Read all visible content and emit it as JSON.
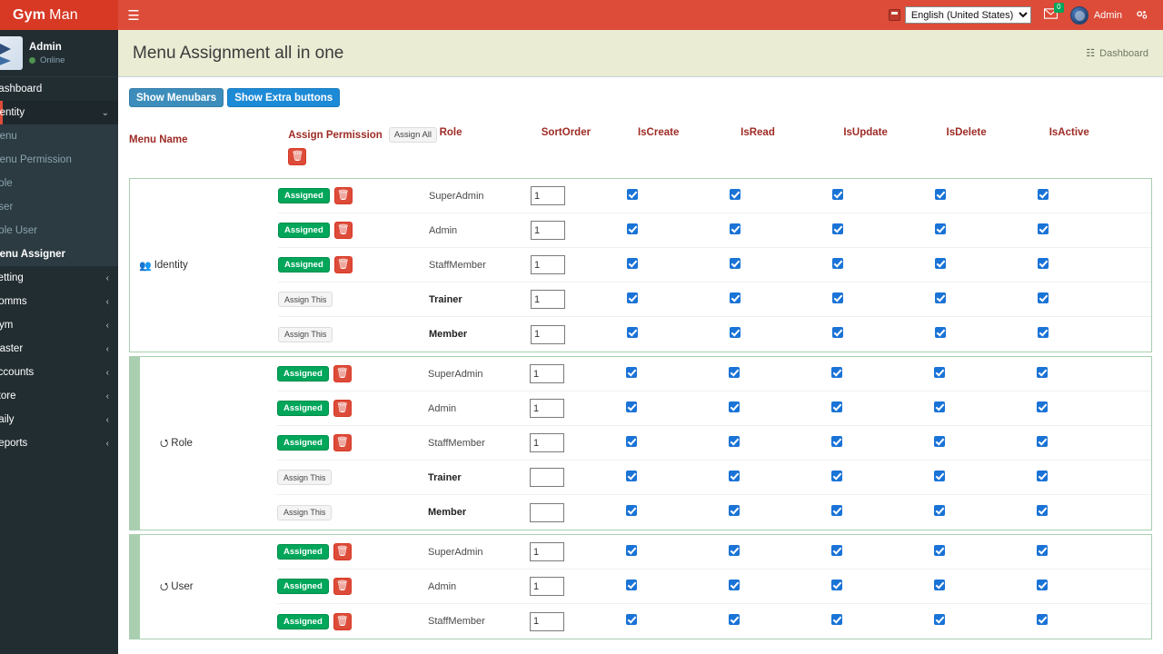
{
  "navbar": {
    "brand_bold": "Gym",
    "brand_light": "Man",
    "toggle_icon": "hamburger-icon",
    "language": {
      "flag_icon": "flag-icon",
      "selected": "English (United States)",
      "options": [
        "English (United States)"
      ]
    },
    "messages": {
      "icon": "envelope-icon",
      "badge": "0"
    },
    "user": {
      "avatar_icon": "avatar-icon",
      "name": "Admin"
    },
    "settings_icon": "gear-icon"
  },
  "sidebar": {
    "user_panel": {
      "name": "Admin",
      "status": "Online"
    },
    "items": [
      {
        "label": "Dashboard",
        "type": "top",
        "caret": ""
      },
      {
        "label": "Identity",
        "type": "active-parent",
        "caret": "⌄"
      },
      {
        "label": "Menu",
        "type": "sub",
        "caret": ""
      },
      {
        "label": "Menu Permission",
        "type": "sub",
        "caret": ""
      },
      {
        "label": "Role",
        "type": "sub",
        "caret": ""
      },
      {
        "label": "User",
        "type": "sub",
        "caret": ""
      },
      {
        "label": "Role User",
        "type": "sub",
        "caret": ""
      },
      {
        "label": "Menu Assigner",
        "type": "sub-active",
        "caret": ""
      },
      {
        "label": "Setting",
        "type": "top",
        "caret": "‹"
      },
      {
        "label": "Comms",
        "type": "top",
        "caret": "‹"
      },
      {
        "label": "Gym",
        "type": "top",
        "caret": "‹"
      },
      {
        "label": "Master",
        "type": "top",
        "caret": "‹"
      },
      {
        "label": "Accounts",
        "type": "top",
        "caret": "‹"
      },
      {
        "label": "Store",
        "type": "top",
        "caret": "‹"
      },
      {
        "label": "Daily",
        "type": "top",
        "caret": "‹"
      },
      {
        "label": "Reports",
        "type": "top",
        "caret": "‹"
      }
    ]
  },
  "page": {
    "title": "Menu Assignment all in one",
    "breadcrumb": {
      "icon": "dashboard-icon",
      "label": "Dashboard"
    }
  },
  "toolbar": {
    "show_menubars": "Show Menubars",
    "show_extra_buttons": "Show Extra buttons"
  },
  "table": {
    "headers": {
      "menu_name": "Menu Name",
      "assign_permission": "Assign Permission",
      "assign_all_button": "Assign All",
      "header_trash_icon": "trash-icon",
      "role": "Role",
      "sort_order": "SortOrder",
      "is_create": "IsCreate",
      "is_read": "IsRead",
      "is_update": "IsUpdate",
      "is_delete": "IsDelete",
      "is_active": "IsActive"
    },
    "labels": {
      "assigned": "Assigned",
      "assign_this": "Assign This",
      "row_trash_icon": "trash-icon"
    },
    "groups": [
      {
        "name": "Identity",
        "icon": "users-icon",
        "thick_border": false,
        "rows": [
          {
            "assigned": true,
            "role": "SuperAdmin",
            "bold": false,
            "sort": "1",
            "create": true,
            "read": true,
            "update": true,
            "delete": true,
            "active": true
          },
          {
            "assigned": true,
            "role": "Admin",
            "bold": false,
            "sort": "1",
            "create": true,
            "read": true,
            "update": true,
            "delete": true,
            "active": true
          },
          {
            "assigned": true,
            "role": "StaffMember",
            "bold": false,
            "sort": "1",
            "create": true,
            "read": true,
            "update": true,
            "delete": true,
            "active": true
          },
          {
            "assigned": false,
            "role": "Trainer",
            "bold": true,
            "sort": "1",
            "create": true,
            "read": true,
            "update": true,
            "delete": true,
            "active": true
          },
          {
            "assigned": false,
            "role": "Member",
            "bold": true,
            "sort": "1",
            "create": true,
            "read": true,
            "update": true,
            "delete": true,
            "active": true
          }
        ]
      },
      {
        "name": "Role",
        "icon": "circle-arrow-icon",
        "thick_border": true,
        "rows": [
          {
            "assigned": true,
            "role": "SuperAdmin",
            "bold": false,
            "sort": "1",
            "create": true,
            "read": true,
            "update": true,
            "delete": true,
            "active": true
          },
          {
            "assigned": true,
            "role": "Admin",
            "bold": false,
            "sort": "1",
            "create": true,
            "read": true,
            "update": true,
            "delete": true,
            "active": true
          },
          {
            "assigned": true,
            "role": "StaffMember",
            "bold": false,
            "sort": "1",
            "create": true,
            "read": true,
            "update": true,
            "delete": true,
            "active": true
          },
          {
            "assigned": false,
            "role": "Trainer",
            "bold": true,
            "sort": "",
            "create": true,
            "read": true,
            "update": true,
            "delete": true,
            "active": true
          },
          {
            "assigned": false,
            "role": "Member",
            "bold": true,
            "sort": "",
            "create": true,
            "read": true,
            "update": true,
            "delete": true,
            "active": true
          }
        ]
      },
      {
        "name": "User",
        "icon": "circle-arrow-icon",
        "thick_border": true,
        "rows": [
          {
            "assigned": true,
            "role": "SuperAdmin",
            "bold": false,
            "sort": "1",
            "create": true,
            "read": true,
            "update": true,
            "delete": true,
            "active": true
          },
          {
            "assigned": true,
            "role": "Admin",
            "bold": false,
            "sort": "1",
            "create": true,
            "read": true,
            "update": true,
            "delete": true,
            "active": true
          },
          {
            "assigned": true,
            "role": "StaffMember",
            "bold": false,
            "sort": "1",
            "create": true,
            "read": true,
            "update": true,
            "delete": true,
            "active": true
          }
        ]
      }
    ]
  }
}
